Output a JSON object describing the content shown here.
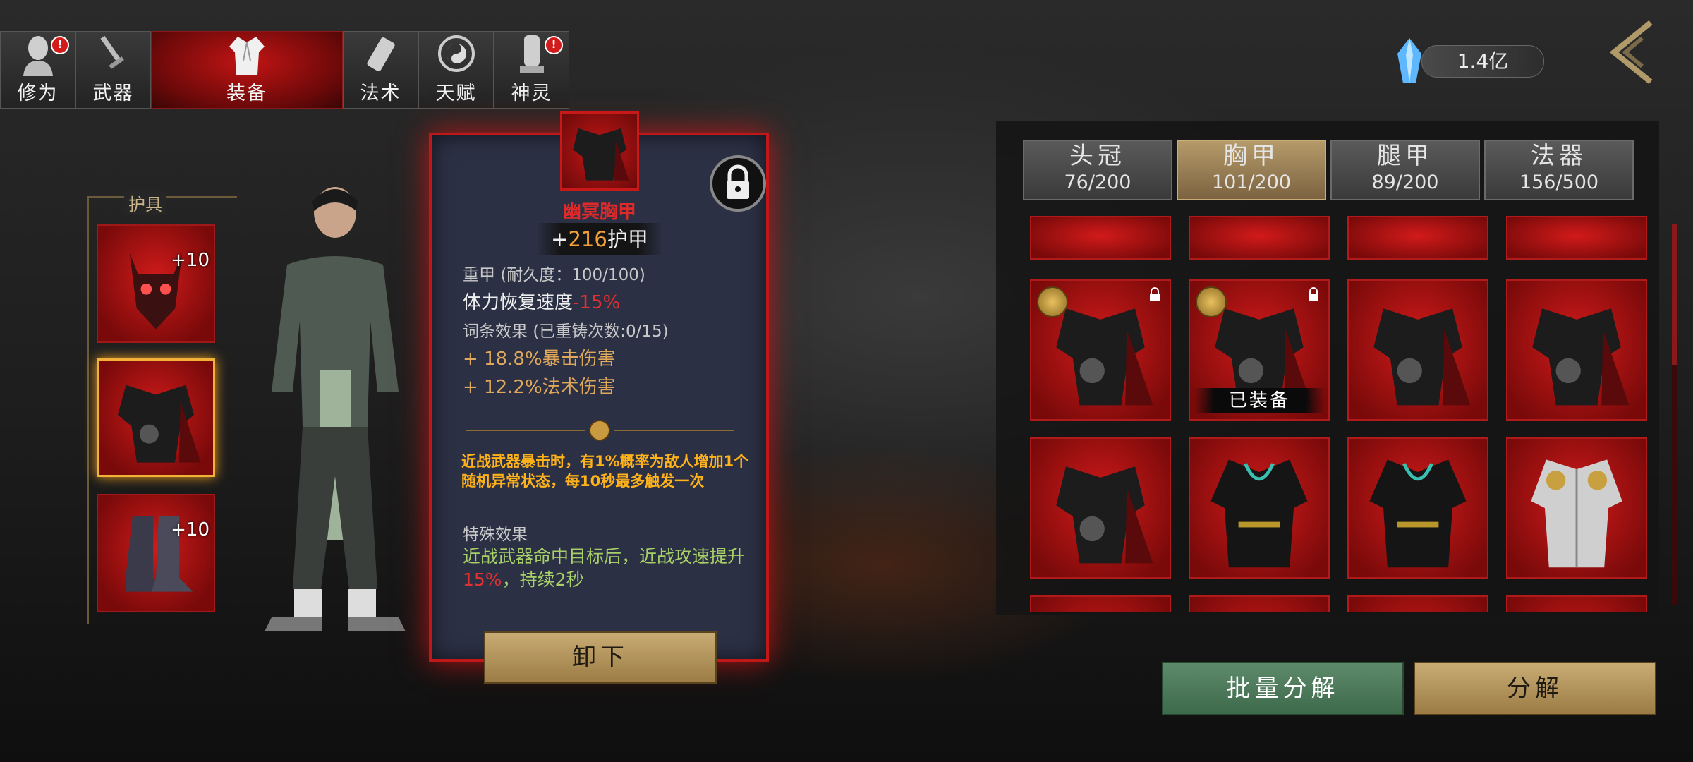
{
  "top_tabs": [
    {
      "label": "修为",
      "icon": "cultivator-head-icon",
      "alert": true
    },
    {
      "label": "武器",
      "icon": "weapon-icon",
      "alert": false
    },
    {
      "label": "装备",
      "icon": "robe-icon",
      "alert": false,
      "active": true
    },
    {
      "label": "法术",
      "icon": "scroll-icon",
      "alert": false
    },
    {
      "label": "天赋",
      "icon": "taiji-icon",
      "alert": false
    },
    {
      "label": "神灵",
      "icon": "spirit-tablet-icon",
      "alert": true
    }
  ],
  "alert_mark": "!",
  "currency": {
    "amount": "1.4亿",
    "icon": "crystal-icon"
  },
  "armor_panel": {
    "label": "护具",
    "slots": [
      {
        "name": "helmet",
        "level": "+10"
      },
      {
        "name": "chest",
        "level": "",
        "selected": true
      },
      {
        "name": "boots",
        "level": "+10"
      }
    ]
  },
  "detail": {
    "name": "幽冥胸甲",
    "armor_prefix": "+",
    "armor_value": "216",
    "armor_suffix": "护甲",
    "type": "重甲",
    "durability": "(耐久度：100/100)",
    "stamina_label": "体力恢复速度",
    "stamina_value": "-15%",
    "affix_title": "词条效果",
    "affix_reforge": "(已重铸次数:0/15)",
    "affixes": [
      "+ 18.8%暴击伤害",
      "+ 12.2%法术伤害"
    ],
    "passive": "近战武器暴击时，有1%概率为敌人增加1个随机异常状态，每10秒最多触发一次",
    "special_title": "特殊效果",
    "special_a": "近战武器命中目标后，近战攻速提升",
    "special_pct": "15%",
    "special_b": "，持续2秒",
    "unequip_label": "卸下"
  },
  "categories": [
    {
      "name": "头冠",
      "count": "76/200"
    },
    {
      "name": "胸甲",
      "count": "101/200",
      "active": true
    },
    {
      "name": "腿甲",
      "count": "89/200"
    },
    {
      "name": "法器",
      "count": "156/500"
    }
  ],
  "grid": {
    "equipped_label": "已装备"
  },
  "buttons": {
    "batch": "批量分解",
    "decompose": "分解"
  },
  "colors": {
    "accent_red": "#c01818",
    "gold": "#c9ab74",
    "green": "#4f7a5b"
  }
}
